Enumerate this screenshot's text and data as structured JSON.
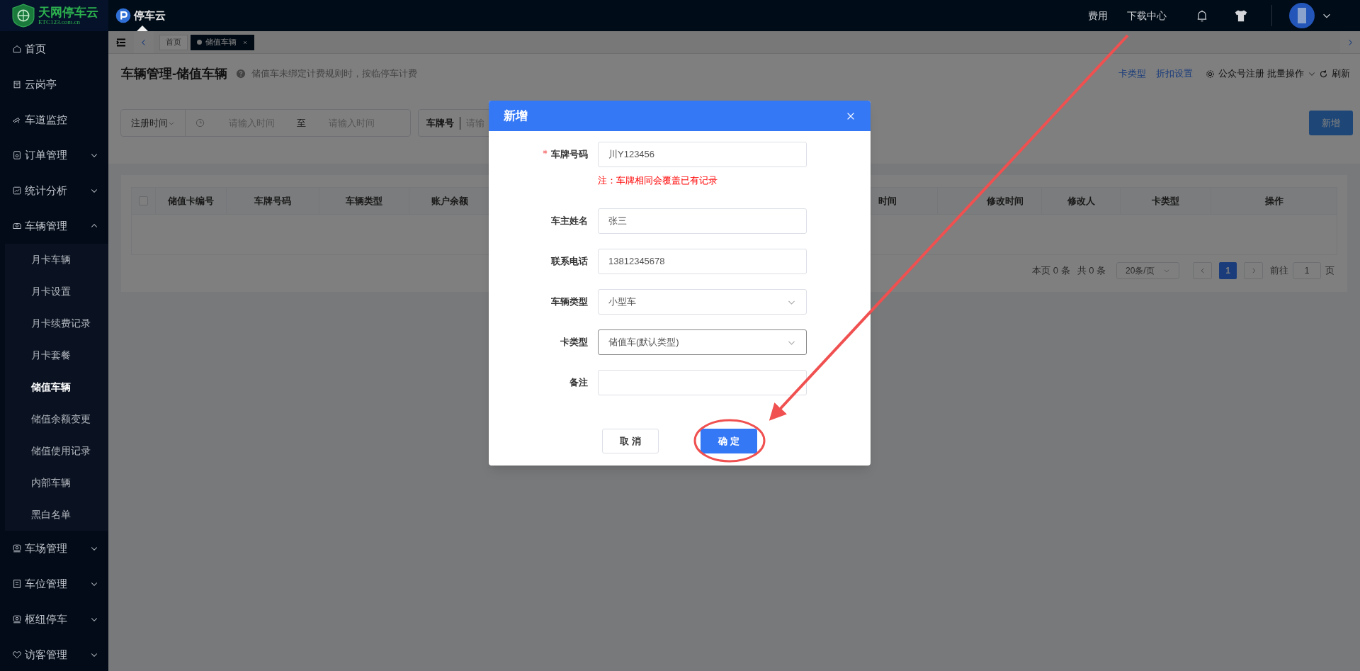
{
  "topbar": {
    "logo_title": "天网停车云",
    "logo_subtitle": "ETC123.com.cn",
    "app_name": "停车云",
    "links": [
      "费用",
      "下载中心"
    ]
  },
  "sidebar": {
    "items": [
      {
        "label": "首页"
      },
      {
        "label": "云岗亭"
      },
      {
        "label": "车道监控"
      },
      {
        "label": "订单管理",
        "expanded": false
      },
      {
        "label": "统计分析",
        "expanded": false
      },
      {
        "label": "车辆管理",
        "expanded": true,
        "children": [
          {
            "label": "月卡车辆",
            "selected": false
          },
          {
            "label": "月卡设置",
            "selected": false
          },
          {
            "label": "月卡续费记录",
            "selected": false
          },
          {
            "label": "月卡套餐",
            "selected": false
          },
          {
            "label": "储值车辆",
            "selected": true
          },
          {
            "label": "储值余额变更",
            "selected": false
          },
          {
            "label": "储值使用记录",
            "selected": false
          },
          {
            "label": "内部车辆",
            "selected": false
          },
          {
            "label": "黑白名单",
            "selected": false
          }
        ]
      },
      {
        "label": "车场管理",
        "expanded": false
      },
      {
        "label": "车位管理",
        "expanded": false
      },
      {
        "label": "枢纽停车",
        "expanded": false
      },
      {
        "label": "访客管理",
        "expanded": false
      }
    ]
  },
  "tabs": [
    {
      "label": "首页",
      "selected": false,
      "closable": false
    },
    {
      "label": "储值车辆",
      "selected": true,
      "closable": true
    }
  ],
  "page": {
    "title": "车辆管理-储值车辆",
    "hint": "储值车未绑定计费规则时，按临停车计费",
    "links": [
      "卡类型",
      "折扣设置"
    ],
    "actions": [
      {
        "label": "公众号注册",
        "kind": "gear"
      },
      {
        "label": "批量操作",
        "kind": "dropdown"
      },
      {
        "label": "刷新",
        "kind": "refresh"
      }
    ],
    "add_button": "新增"
  },
  "filters": {
    "time_select": "注册时间",
    "start_placeholder": "请输入时间",
    "separator": "至",
    "end_placeholder": "请输入时间",
    "plate_label": "车牌号",
    "plate_placeholder": "请输"
  },
  "table": {
    "select_all_checked": false,
    "columns": [
      "储值卡编号",
      "车牌号码",
      "车辆类型",
      "账户余额",
      "时间",
      "修改时间",
      "修改人",
      "卡类型",
      "操作"
    ]
  },
  "pagination": {
    "page_rows": "本页 0 条",
    "total": "共 0 条",
    "page_size": "20条/页",
    "pages": [
      {
        "label": "1",
        "selected": true
      }
    ],
    "goto_label": "前往",
    "goto_value": "1",
    "goto_suffix": "页"
  },
  "dialog": {
    "title": "新增",
    "fields": [
      {
        "label": "车牌号码",
        "required": true,
        "kind": "input",
        "value": "川Y123456",
        "focused": false,
        "note": "注：车牌相同会覆盖已有记录"
      },
      {
        "label": "车主姓名",
        "required": false,
        "kind": "input",
        "value": "张三",
        "focused": false
      },
      {
        "label": "联系电话",
        "required": false,
        "kind": "input",
        "value": "13812345678",
        "focused": false
      },
      {
        "label": "车辆类型",
        "required": false,
        "kind": "select",
        "value": "小型车",
        "focused": false
      },
      {
        "label": "卡类型",
        "required": false,
        "kind": "select",
        "value": "储值车(默认类型)",
        "focused": true
      },
      {
        "label": "备注",
        "required": false,
        "kind": "input",
        "focused": false
      }
    ],
    "buttons": [
      {
        "label": "取 消",
        "kind": "default"
      },
      {
        "label": "确 定",
        "kind": "primary"
      }
    ]
  }
}
